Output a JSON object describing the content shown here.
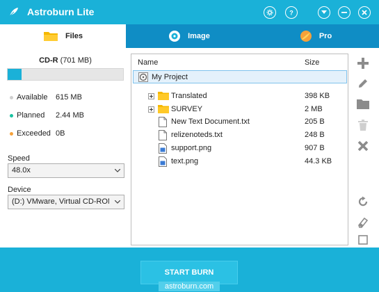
{
  "window": {
    "title": "Astroburn Lite"
  },
  "tabs": [
    {
      "label": "Files",
      "icon": "folder-icon",
      "active": true
    },
    {
      "label": "Image",
      "icon": "disc-icon",
      "active": false
    },
    {
      "label": "Pro",
      "icon": "pro-icon",
      "active": false
    }
  ],
  "disc": {
    "type": "CD-R",
    "capacity": "(701 MB)",
    "used_fraction": 0.12
  },
  "stats": [
    {
      "label": "Available",
      "value": "615 MB",
      "color": "#cfcfcf"
    },
    {
      "label": "Planned",
      "value": "2.44 MB",
      "color": "#19c2a0"
    },
    {
      "label": "Exceeded",
      "value": "0B",
      "color": "#f5a13a"
    }
  ],
  "speed": {
    "label": "Speed",
    "value": "48.0x"
  },
  "device": {
    "label": "Device",
    "value": "(D:) VMware, Virtual CD-ROM"
  },
  "filelist": {
    "columns": {
      "name": "Name",
      "size": "Size"
    },
    "root": "My Project",
    "items": [
      {
        "name": "Translated",
        "size": "398 KB",
        "type": "folder"
      },
      {
        "name": "SURVEY",
        "size": "2 MB",
        "type": "folder"
      },
      {
        "name": "New Text Document.txt",
        "size": "205 B",
        "type": "text"
      },
      {
        "name": "relizenoteds.txt",
        "size": "248 B",
        "type": "text"
      },
      {
        "name": "support.png",
        "size": "907 B",
        "type": "image"
      },
      {
        "name": "text.png",
        "size": "44.3 KB",
        "type": "image"
      }
    ]
  },
  "toolbar": [
    "add-icon",
    "edit-icon",
    "new-folder-icon",
    "delete-icon",
    "remove-icon",
    "refresh-icon",
    "eraser-icon",
    "select-icon"
  ],
  "actions": {
    "start": "START BURN",
    "site": "astroburn.com"
  },
  "colors": {
    "accent": "#1ab1d8",
    "tab_inactive": "#0f8dc5",
    "folder": "#f5b800"
  }
}
